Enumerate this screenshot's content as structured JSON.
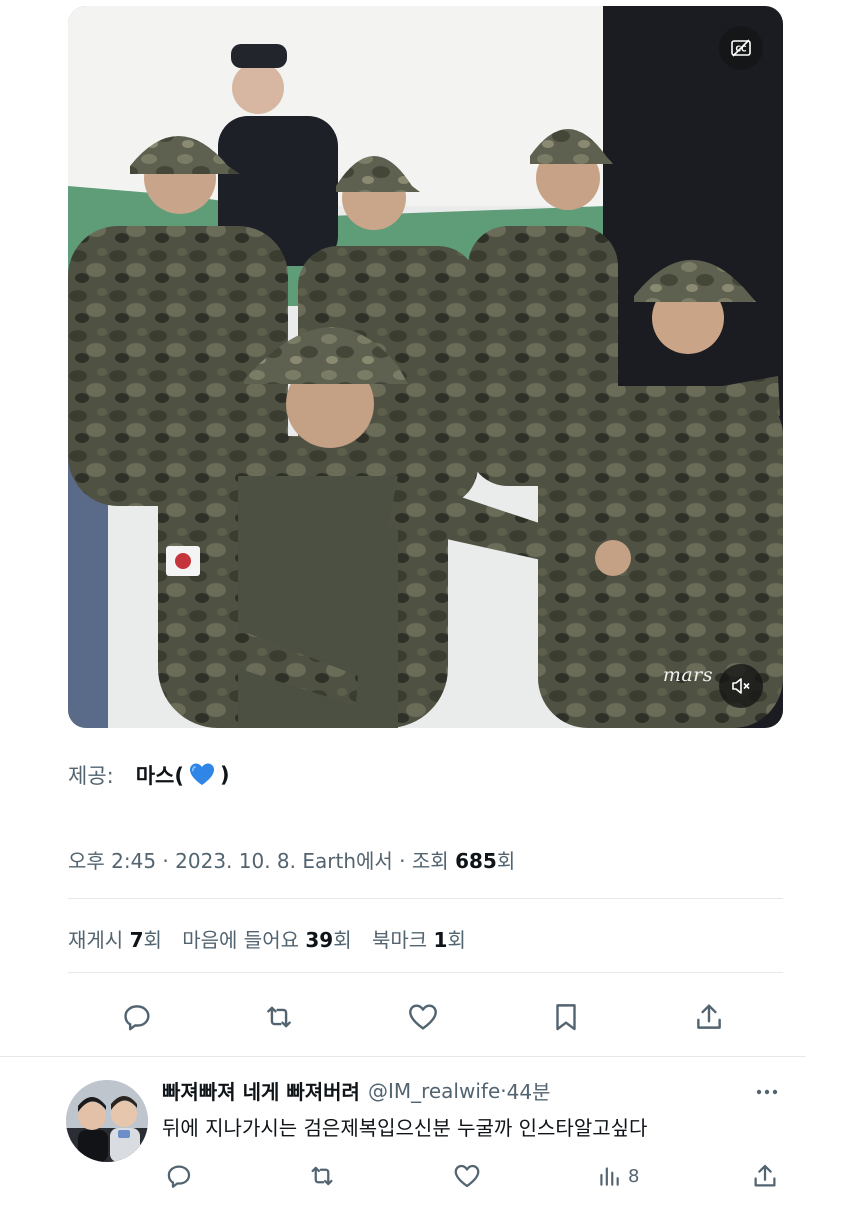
{
  "media": {
    "watermark": "mars",
    "captions_icon": "closed-captions-off-icon",
    "mute_icon": "volume-muted-icon"
  },
  "credit": {
    "label": "제공:",
    "name_prefix": "마스(",
    "emoji": "blue-heart",
    "name_suffix": ")"
  },
  "meta": {
    "time": "오후 2:45",
    "sep1": " · ",
    "date": "2023. 10. 8.",
    "location": " Earth에서",
    "sep2": " · ",
    "views_label": "조회 ",
    "views_count": "685",
    "views_unit": "회"
  },
  "stats": {
    "reposts_label": "재게시 ",
    "reposts_count": "7",
    "reposts_unit": "회",
    "likes_label": "마음에 들어요 ",
    "likes_count": "39",
    "likes_unit": "회",
    "bookmarks_label": "북마크 ",
    "bookmarks_count": "1",
    "bookmarks_unit": "회"
  },
  "actions": [
    "reply-icon",
    "repost-icon",
    "like-icon",
    "bookmark-icon",
    "share-icon"
  ],
  "reply": {
    "name": "빠져빠져 네게 빠져버려",
    "handle": "@IM_realwife",
    "sep": " · ",
    "time": "44분",
    "text": "뒤에 지나가시는 검은제복입으신분 누굴까 인스타알고싶다",
    "views_count": "8"
  },
  "colors": {
    "text_primary": "#0f1419",
    "text_secondary": "#536471",
    "divider": "#e6e9ec",
    "heart_blue": "#2f86e6"
  }
}
